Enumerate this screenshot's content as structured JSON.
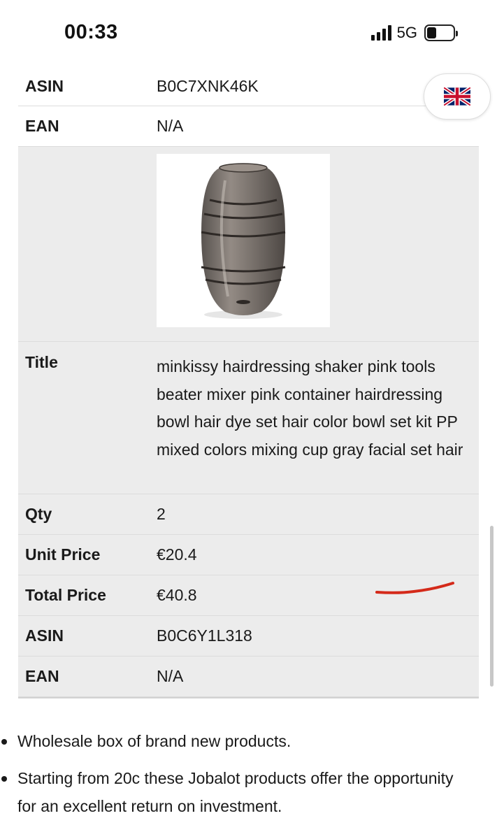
{
  "status": {
    "time": "00:33",
    "network": "5G",
    "signal_bars": 4,
    "battery_level": 0.35
  },
  "lang_button": {
    "icon": "uk-flag-icon"
  },
  "rows": [
    {
      "key": "ASIN",
      "value": "B0C7XNK46K"
    },
    {
      "key": "EAN",
      "value": "N/A"
    },
    {
      "key": "Title",
      "value": "minkissy hairdressing shaker pink tools beater mixer pink container hairdressing bowl hair dye set hair color bowl set kit PP mixed colors mixing cup gray facial set hair"
    },
    {
      "key": "Qty",
      "value": "2"
    },
    {
      "key": "Unit Price",
      "value": "€20.4"
    },
    {
      "key": "Total Price",
      "value": "€40.8"
    },
    {
      "key": "ASIN",
      "value": "B0C6Y1L318"
    },
    {
      "key": "EAN",
      "value": "N/A"
    }
  ],
  "product_image": {
    "icon": "product-image-gray-mixing-cup"
  },
  "bullets": [
    "Wholesale box of brand new products.",
    "Starting from 20c these Jobalot products offer the opportunity for an excellent return on investment."
  ],
  "colors": {
    "row_bg": "#ececec",
    "annotation": "#d42a1a"
  }
}
